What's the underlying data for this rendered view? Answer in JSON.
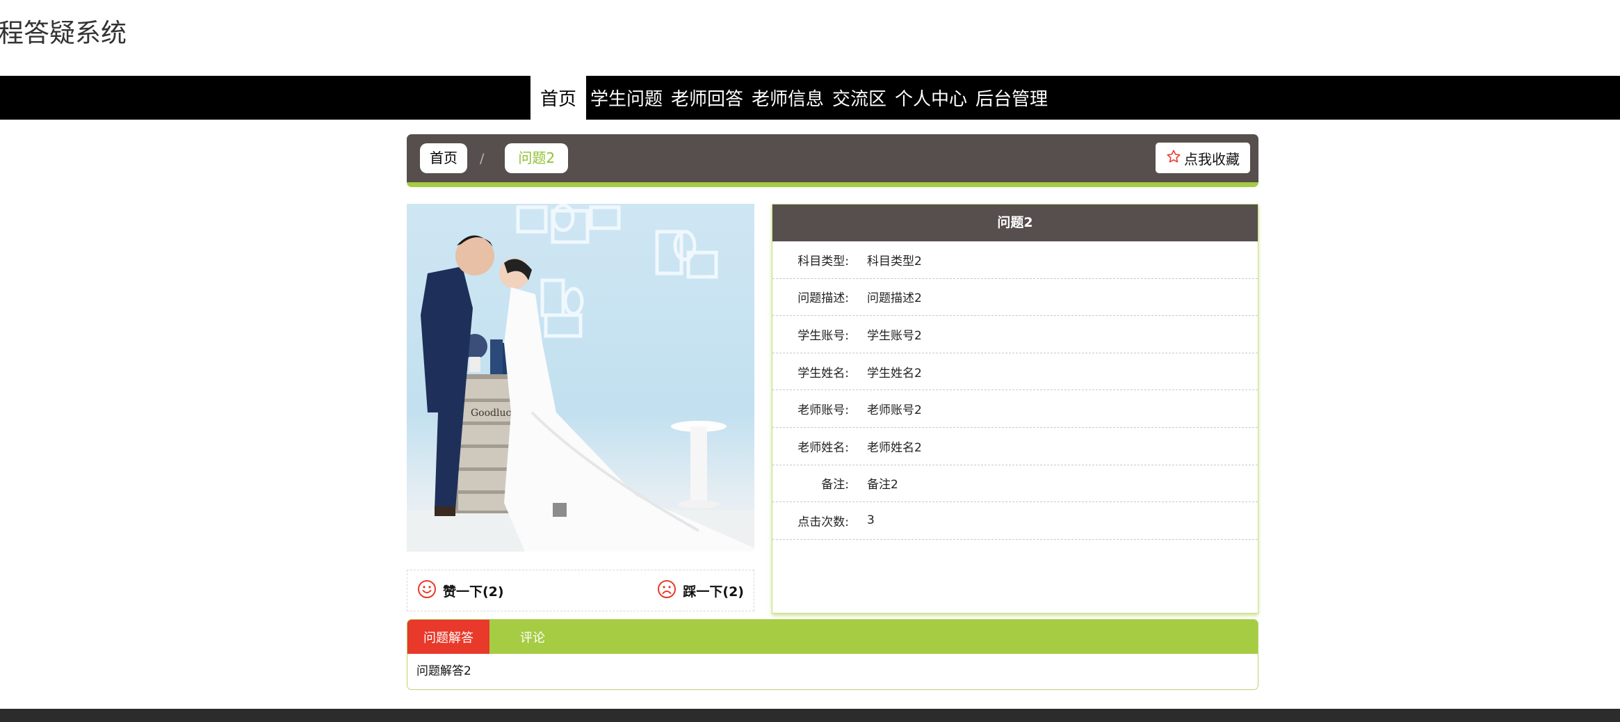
{
  "site": {
    "title": "课程答疑系统"
  },
  "nav": {
    "items": [
      {
        "label": "首页"
      },
      {
        "label": "学生问题"
      },
      {
        "label": "老师回答"
      },
      {
        "label": "老师信息"
      },
      {
        "label": "交流区"
      },
      {
        "label": "个人中心"
      },
      {
        "label": "后台管理"
      }
    ]
  },
  "breadcrumb": {
    "home": "首页",
    "separator": "/",
    "current": "问题2"
  },
  "favorite": {
    "label": "点我收藏"
  },
  "votes": {
    "like": "赞一下(2)",
    "dislike": "踩一下(2)"
  },
  "detail": {
    "title": "问题2",
    "rows": [
      {
        "label": "科目类型:",
        "value": "科目类型2"
      },
      {
        "label": "问题描述:",
        "value": "问题描述2"
      },
      {
        "label": "学生账号:",
        "value": "学生账号2"
      },
      {
        "label": "学生姓名:",
        "value": "学生姓名2"
      },
      {
        "label": "老师账号:",
        "value": "老师账号2"
      },
      {
        "label": "老师姓名:",
        "value": "老师姓名2"
      },
      {
        "label": "备注:",
        "value": "备注2"
      },
      {
        "label": "点击次数:",
        "value": "3"
      }
    ]
  },
  "tabs": {
    "items": [
      {
        "label": "问题解答"
      },
      {
        "label": "评论"
      }
    ],
    "content": "问题解答2"
  },
  "photo": {
    "caption": "Goodluck"
  },
  "colors": {
    "accent_green": "#a5cc42",
    "header_brown": "#574f4d",
    "tab_red": "#e8392a",
    "nav_black": "#000000"
  },
  "icons": {
    "favorite": "star-outline-icon",
    "like": "smile-icon",
    "dislike": "frown-icon"
  }
}
